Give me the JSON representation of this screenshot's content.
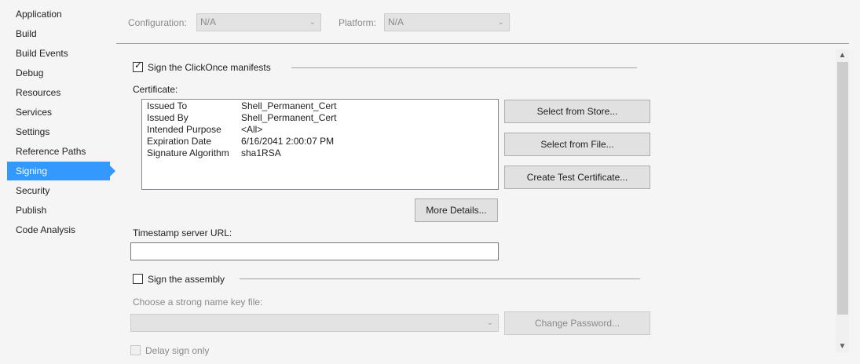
{
  "sidebar": {
    "items": [
      {
        "label": "Application"
      },
      {
        "label": "Build"
      },
      {
        "label": "Build Events"
      },
      {
        "label": "Debug"
      },
      {
        "label": "Resources"
      },
      {
        "label": "Services"
      },
      {
        "label": "Settings"
      },
      {
        "label": "Reference Paths"
      },
      {
        "label": "Signing"
      },
      {
        "label": "Security"
      },
      {
        "label": "Publish"
      },
      {
        "label": "Code Analysis"
      }
    ],
    "active": "Signing"
  },
  "topbar": {
    "configuration_label": "Configuration:",
    "configuration_value": "N/A",
    "platform_label": "Platform:",
    "platform_value": "N/A"
  },
  "signing": {
    "sign_manifests_label": "Sign the ClickOnce manifests",
    "sign_manifests_checked": true,
    "certificate_label": "Certificate:",
    "certificate": [
      {
        "key": "Issued To",
        "value": "Shell_Permanent_Cert"
      },
      {
        "key": "Issued By",
        "value": "Shell_Permanent_Cert"
      },
      {
        "key": "Intended Purpose",
        "value": "<All>"
      },
      {
        "key": "Expiration Date",
        "value": "6/16/2041 2:00:07 PM"
      },
      {
        "key": "Signature Algorithm",
        "value": "sha1RSA"
      }
    ],
    "select_from_store": "Select from Store...",
    "select_from_file": "Select from File...",
    "create_test_certificate": "Create Test Certificate...",
    "more_details": "More Details...",
    "timestamp_label": "Timestamp server URL:",
    "timestamp_value": "",
    "sign_assembly_label": "Sign the assembly",
    "sign_assembly_checked": false,
    "strong_name_label": "Choose a strong name key file:",
    "strong_name_value": "",
    "change_password": "Change Password...",
    "delay_sign_label": "Delay sign only"
  }
}
